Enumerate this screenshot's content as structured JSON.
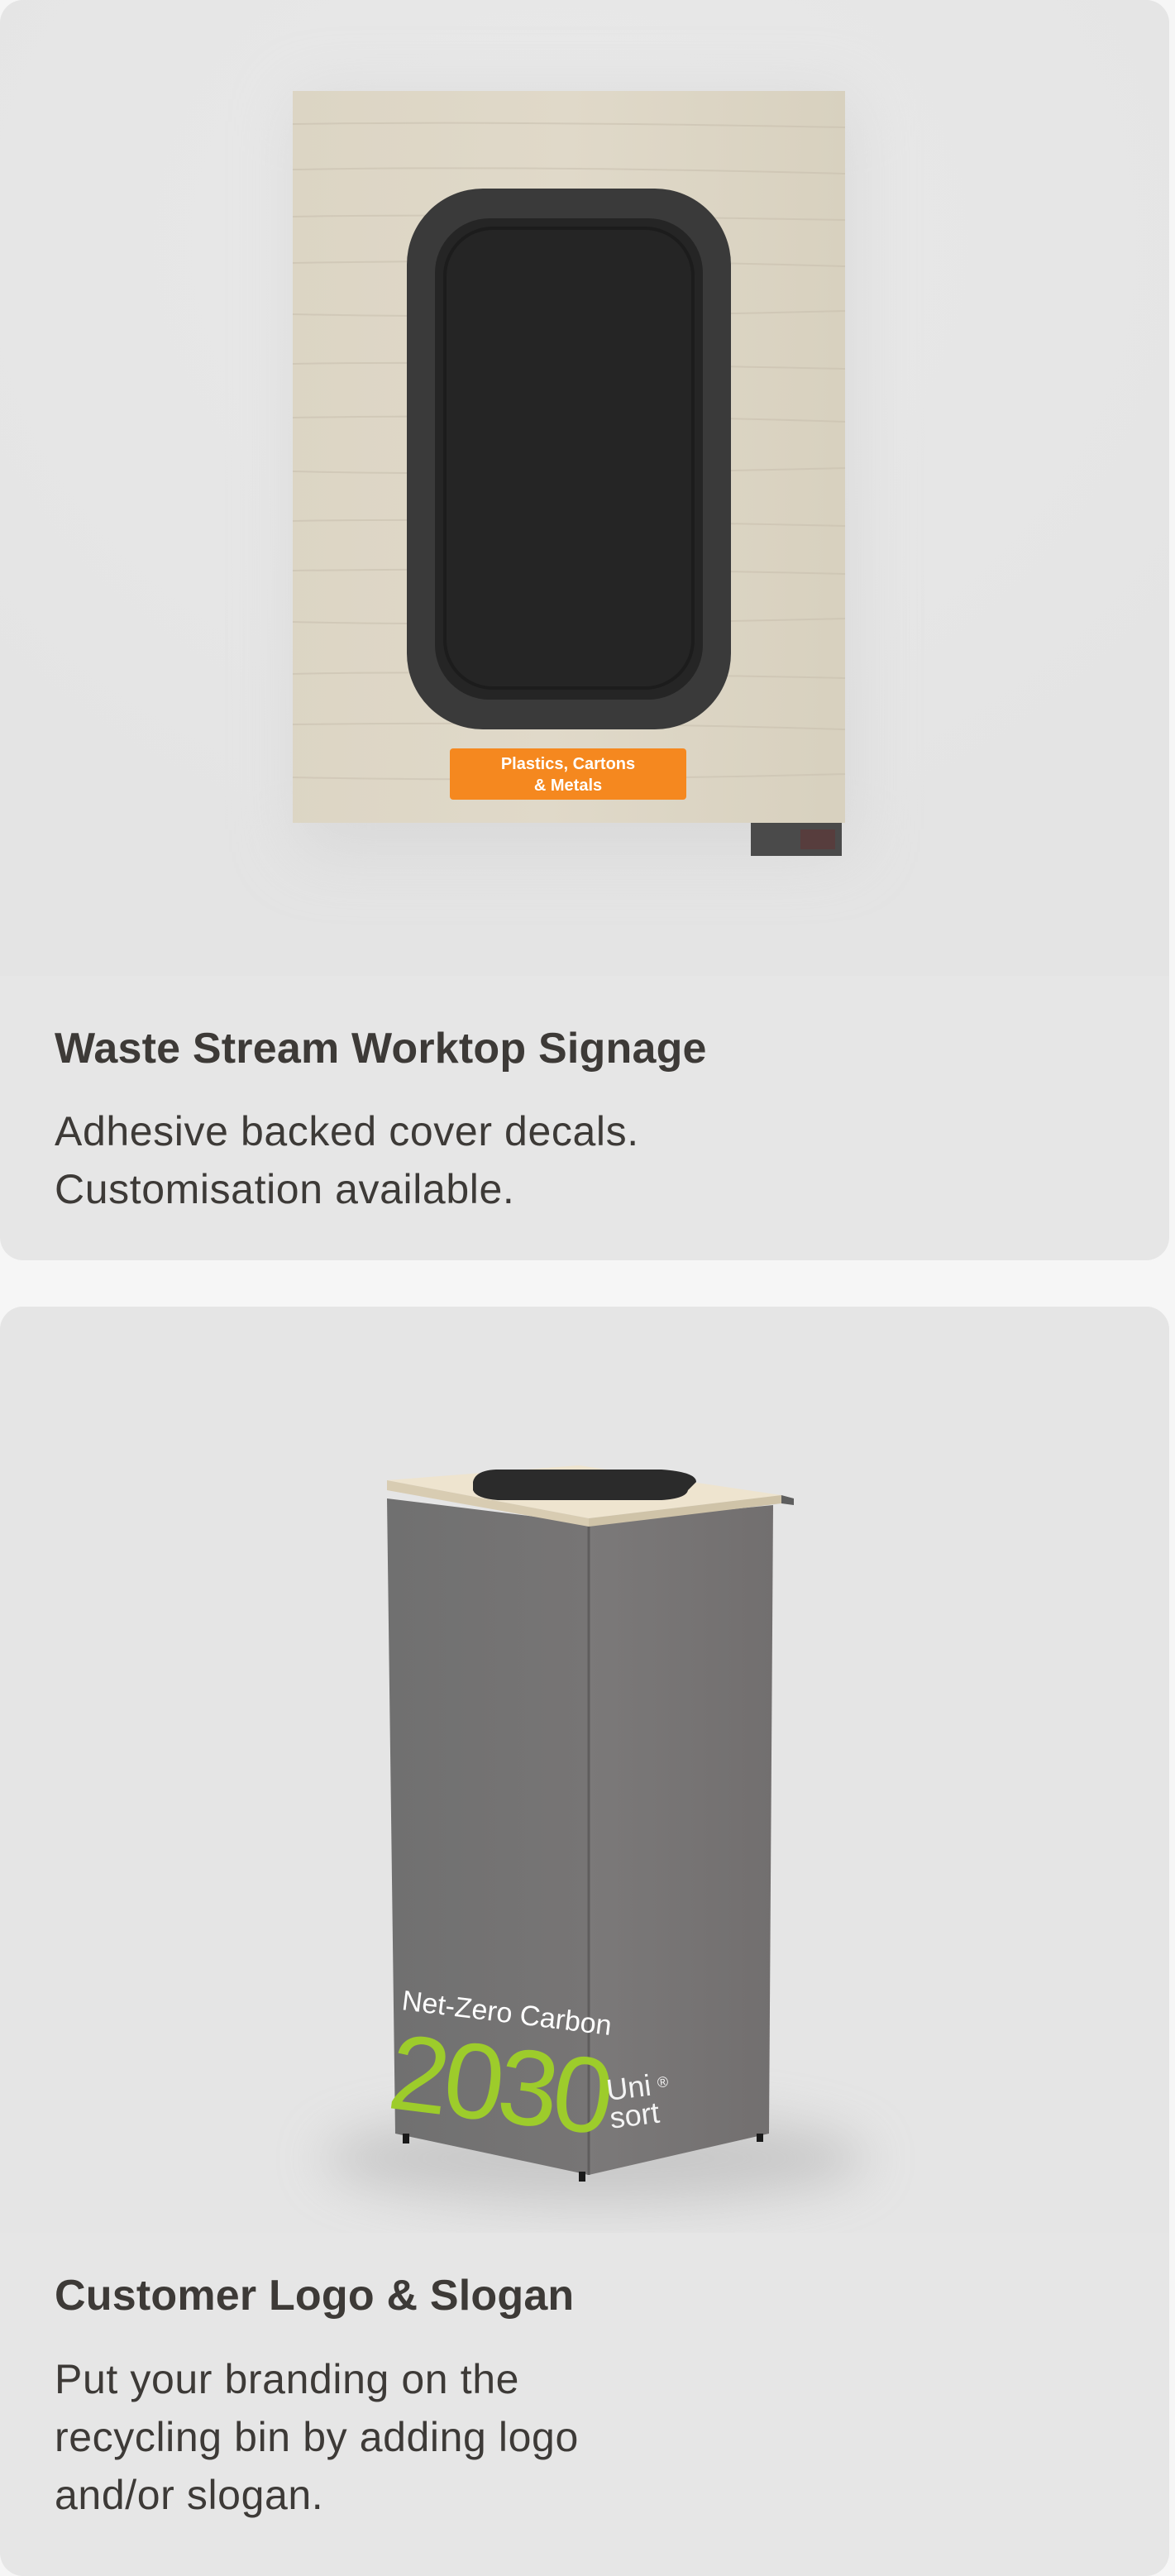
{
  "cards": [
    {
      "title": "Waste Stream Worktop Signage",
      "description_line1": "Adhesive backed cover decals.",
      "description_line2": "Customisation available.",
      "image": {
        "subject": "worktop-signage-panel",
        "label_line1": "Plastics, Cartons",
        "label_line2": "& Metals",
        "label_color": "#f5881f",
        "panel_wood_color": "#ddd6c6",
        "cutout_color": "#262626"
      }
    },
    {
      "title": "Customer Logo & Slogan",
      "description_line1": "Put your branding on the",
      "description_line2": "recycling bin by adding logo",
      "description_line3": "and/or slogan.",
      "image": {
        "subject": "branded-recycling-bin",
        "slogan_line1": "Net-Zero Carbon",
        "slogan_line2": "2030",
        "logo_line1": "Uni",
        "logo_line2": "sort",
        "logo_mark": "®",
        "slogan_accent_color": "#9dcc2b",
        "bin_body_color": "#757373",
        "lid_color": "#eee4cf"
      }
    }
  ]
}
